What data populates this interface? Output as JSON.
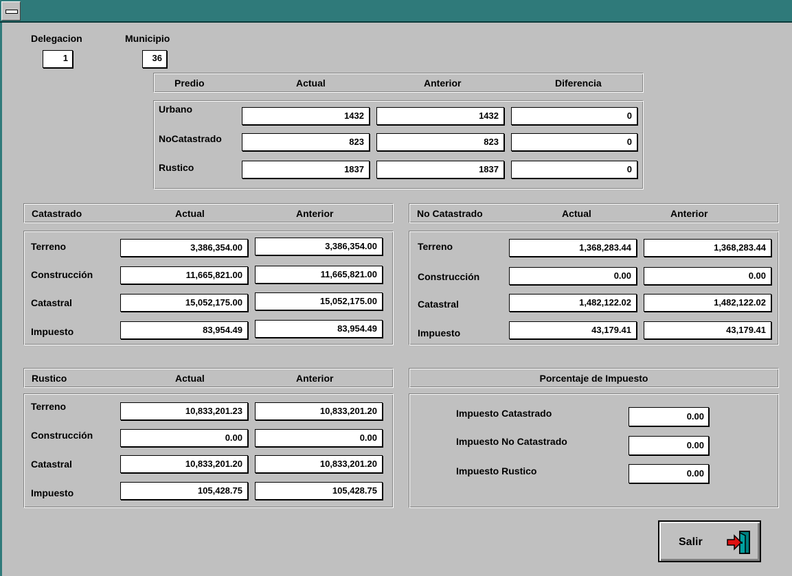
{
  "header": {
    "delegacion_label": "Delegacion",
    "delegacion_value": "1",
    "municipio_label": "Municipio",
    "municipio_value": "36"
  },
  "predio": {
    "headers": [
      "Predio",
      "Actual",
      "Anterior",
      "Diferencia"
    ],
    "rows": [
      {
        "label": "Urbano",
        "actual": "1432",
        "anterior": "1432",
        "diferencia": "0"
      },
      {
        "label": "NoCatastrado",
        "actual": "823",
        "anterior": "823",
        "diferencia": "0"
      },
      {
        "label": "Rustico",
        "actual": "1837",
        "anterior": "1837",
        "diferencia": "0"
      }
    ]
  },
  "catastrado": {
    "headers": [
      "Catastrado",
      "Actual",
      "Anterior"
    ],
    "rows": [
      {
        "label": "Terreno",
        "actual": "3,386,354.00",
        "anterior": "3,386,354.00"
      },
      {
        "label": "Construcción",
        "actual": "11,665,821.00",
        "anterior": "11,665,821.00"
      },
      {
        "label": "Catastral",
        "actual": "15,052,175.00",
        "anterior": "15,052,175.00"
      },
      {
        "label": "Impuesto",
        "actual": "83,954.49",
        "anterior": "83,954.49"
      }
    ]
  },
  "no_catastrado": {
    "headers": [
      "No Catastrado",
      "Actual",
      "Anterior"
    ],
    "rows": [
      {
        "label": "Terreno",
        "actual": "1,368,283.44",
        "anterior": "1,368,283.44"
      },
      {
        "label": "Construcción",
        "actual": "0.00",
        "anterior": "0.00"
      },
      {
        "label": "Catastral",
        "actual": "1,482,122.02",
        "anterior": "1,482,122.02"
      },
      {
        "label": "Impuesto",
        "actual": "43,179.41",
        "anterior": "43,179.41"
      }
    ]
  },
  "rustico": {
    "headers": [
      "Rustico",
      "Actual",
      "Anterior"
    ],
    "rows": [
      {
        "label": "Terreno",
        "actual": "10,833,201.23",
        "anterior": "10,833,201.20"
      },
      {
        "label": "Construcción",
        "actual": "0.00",
        "anterior": "0.00"
      },
      {
        "label": "Catastral",
        "actual": "10,833,201.20",
        "anterior": "10,833,201.20"
      },
      {
        "label": "Impuesto",
        "actual": "105,428.75",
        "anterior": "105,428.75"
      }
    ]
  },
  "porcentaje": {
    "title": "Porcentaje de Impuesto",
    "rows": [
      {
        "label": "Impuesto Catastrado",
        "value": "0.00"
      },
      {
        "label": "Impuesto No Catastrado",
        "value": "0.00"
      },
      {
        "label": "Impuesto Rustico",
        "value": "0.00"
      }
    ]
  },
  "buttons": {
    "salir_label": "Salir"
  },
  "icons": {
    "system_menu": "system-menu-icon",
    "exit": "exit-door-icon"
  },
  "colors": {
    "titlebar": "#2f7a7a",
    "background": "#c0c0c0",
    "arrow": "#e01010",
    "door": "#008080"
  }
}
